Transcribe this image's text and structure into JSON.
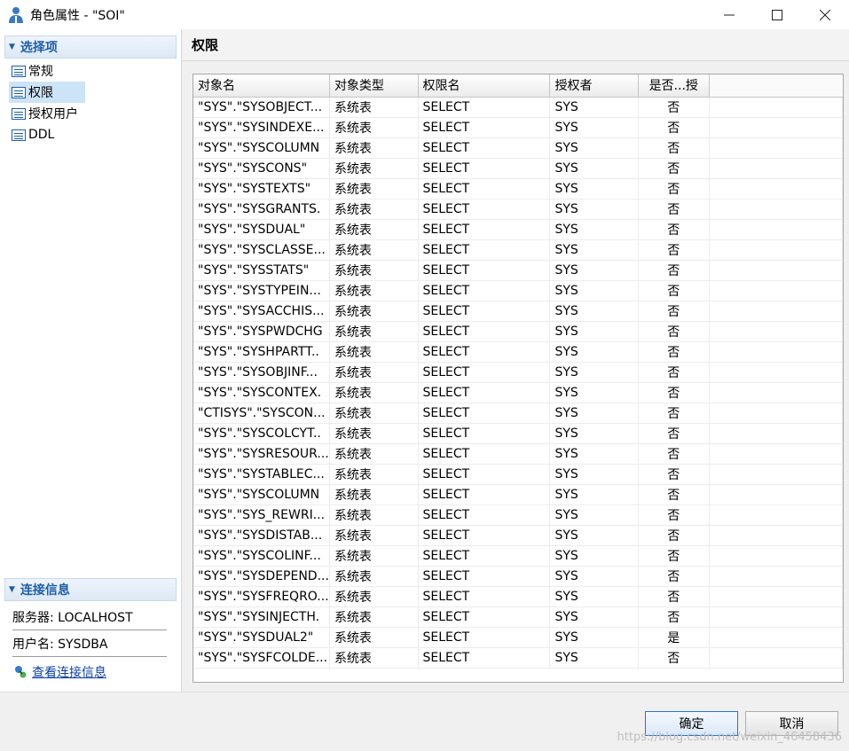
{
  "window": {
    "title": "角色属性 - \"SOI\"",
    "controls": {
      "minimize": "—",
      "maximize": "☐",
      "close": "✕"
    }
  },
  "sidebar": {
    "section_title": "选择项",
    "items": [
      {
        "label": "常规"
      },
      {
        "label": "权限"
      },
      {
        "label": "授权用户"
      },
      {
        "label": "DDL"
      }
    ],
    "connection": {
      "section_title": "连接信息",
      "server": "服务器: LOCALHOST",
      "user": "用户名: SYSDBA",
      "link": "查看连接信息"
    }
  },
  "main": {
    "title": "权限",
    "table": {
      "headers": [
        "对象名",
        "对象类型",
        "权限名",
        "授权者",
        "是否...授"
      ],
      "rows": [
        [
          "\"SYS\".\"SYSOBJECT...",
          "系统表",
          "SELECT",
          "SYS",
          "否"
        ],
        [
          "\"SYS\".\"SYSINDEXE...",
          "系统表",
          "SELECT",
          "SYS",
          "否"
        ],
        [
          "\"SYS\".\"SYSCOLUMN",
          "系统表",
          "SELECT",
          "SYS",
          "否"
        ],
        [
          "\"SYS\".\"SYSCONS\"",
          "系统表",
          "SELECT",
          "SYS",
          "否"
        ],
        [
          "\"SYS\".\"SYSTEXTS\"",
          "系统表",
          "SELECT",
          "SYS",
          "否"
        ],
        [
          "\"SYS\".\"SYSGRANTS.",
          "系统表",
          "SELECT",
          "SYS",
          "否"
        ],
        [
          "\"SYS\".\"SYSDUAL\"",
          "系统表",
          "SELECT",
          "SYS",
          "否"
        ],
        [
          "\"SYS\".\"SYSCLASSE...",
          "系统表",
          "SELECT",
          "SYS",
          "否"
        ],
        [
          "\"SYS\".\"SYSSTATS\"",
          "系统表",
          "SELECT",
          "SYS",
          "否"
        ],
        [
          "\"SYS\".\"SYSTYPEIN...",
          "系统表",
          "SELECT",
          "SYS",
          "否"
        ],
        [
          "\"SYS\".\"SYSACCHIS...",
          "系统表",
          "SELECT",
          "SYS",
          "否"
        ],
        [
          "\"SYS\".\"SYSPWDCHG",
          "系统表",
          "SELECT",
          "SYS",
          "否"
        ],
        [
          "\"SYS\".\"SYSHPARTT..",
          "系统表",
          "SELECT",
          "SYS",
          "否"
        ],
        [
          "\"SYS\".\"SYSOBJINF...",
          "系统表",
          "SELECT",
          "SYS",
          "否"
        ],
        [
          "\"SYS\".\"SYSCONTEX.",
          "系统表",
          "SELECT",
          "SYS",
          "否"
        ],
        [
          "\"CTISYS\".\"SYSCON...",
          "系统表",
          "SELECT",
          "SYS",
          "否"
        ],
        [
          "\"SYS\".\"SYSCOLCYT..",
          "系统表",
          "SELECT",
          "SYS",
          "否"
        ],
        [
          "\"SYS\".\"SYSRESOUR...",
          "系统表",
          "SELECT",
          "SYS",
          "否"
        ],
        [
          "\"SYS\".\"SYSTABLEC...",
          "系统表",
          "SELECT",
          "SYS",
          "否"
        ],
        [
          "\"SYS\".\"SYSCOLUMN",
          "系统表",
          "SELECT",
          "SYS",
          "否"
        ],
        [
          "\"SYS\".\"SYS_REWRI...",
          "系统表",
          "SELECT",
          "SYS",
          "否"
        ],
        [
          "\"SYS\".\"SYSDISTAB...",
          "系统表",
          "SELECT",
          "SYS",
          "否"
        ],
        [
          "\"SYS\".\"SYSCOLINF...",
          "系统表",
          "SELECT",
          "SYS",
          "否"
        ],
        [
          "\"SYS\".\"SYSDEPEND...",
          "系统表",
          "SELECT",
          "SYS",
          "否"
        ],
        [
          "\"SYS\".\"SYSFREQRO...",
          "系统表",
          "SELECT",
          "SYS",
          "否"
        ],
        [
          "\"SYS\".\"SYSINJECTH.",
          "系统表",
          "SELECT",
          "SYS",
          "否"
        ],
        [
          "\"SYS\".\"SYSDUAL2\"",
          "系统表",
          "SELECT",
          "SYS",
          "是"
        ],
        [
          "\"SYS\".\"SYSFCOLDE...",
          "系统表",
          "SELECT",
          "SYS",
          "否"
        ]
      ]
    }
  },
  "buttons": {
    "ok": "确定",
    "cancel": "取消"
  },
  "watermark": "https://blog.csdn.net/weixin_46458436",
  "colors": {
    "accent": "#1c5fa8",
    "selection": "#cde3f7",
    "link": "#0a3fa8"
  }
}
